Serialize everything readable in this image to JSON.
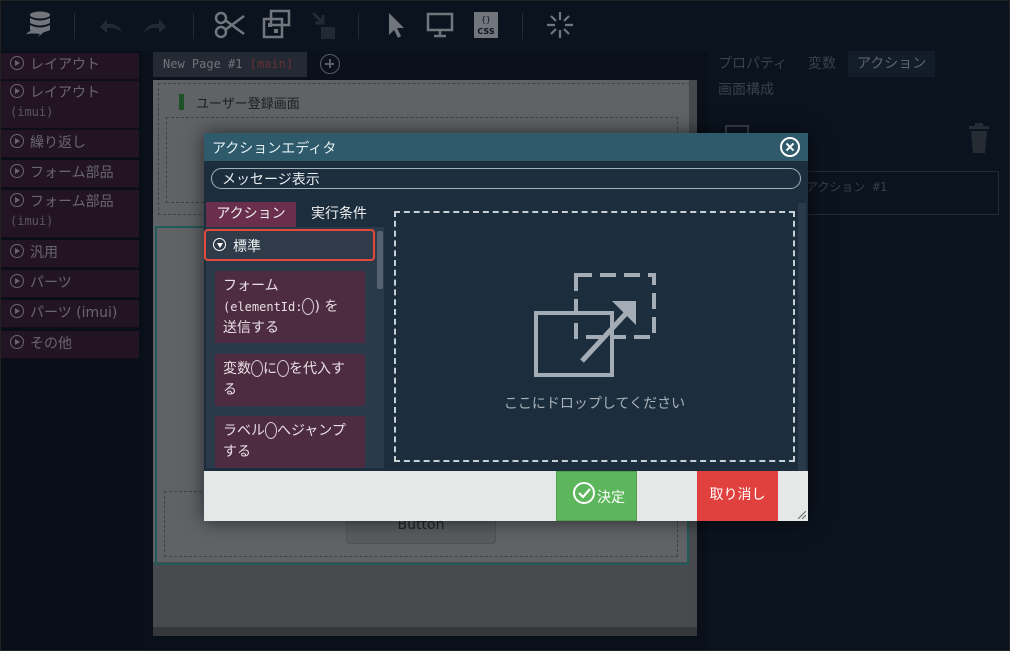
{
  "toolbar": {
    "icons": [
      "database-icon",
      "undo-icon",
      "redo-icon",
      "scissors-icon",
      "copy-icon",
      "paste-icon",
      "cursor-icon",
      "monitor-icon",
      "css-icon",
      "sparkle-icon"
    ],
    "css_label": "CSS"
  },
  "palette": {
    "items": [
      {
        "label": "レイアウト",
        "sub": ""
      },
      {
        "label": "レイアウト",
        "sub": "(imui)"
      },
      {
        "label": "繰り返し",
        "sub": ""
      },
      {
        "label": "フォーム部品",
        "sub": ""
      },
      {
        "label": "フォーム部品",
        "sub": "(imui)"
      },
      {
        "label": "汎用",
        "sub": ""
      },
      {
        "label": "パーツ",
        "sub": ""
      },
      {
        "label": "パーツ (imui)",
        "sub": ""
      },
      {
        "label": "その他",
        "sub": ""
      }
    ]
  },
  "page_tab": {
    "name": "New Page #1",
    "tag": "[main]"
  },
  "canvas": {
    "heading": "ユーザー登録画面",
    "button_label": "Button"
  },
  "right_panel": {
    "tabs": [
      "プロパティ",
      "変数",
      "アクション",
      "画面構成"
    ],
    "action_item": "アクション #1"
  },
  "modal": {
    "title": "アクションエディタ",
    "name_value": "メッセージ表示",
    "tab_action": "アクション",
    "tab_condition": "実行条件",
    "category": "標準",
    "cards": [
      {
        "line1": "フォーム",
        "line2a": "(elementId:",
        "line2b": ") を",
        "line3": "送信する"
      },
      {
        "line1a": "変数",
        "line1b": "に",
        "line1c": "を代入す",
        "line2": "る"
      },
      {
        "line1a": "ラベル",
        "line1b": "へジャンプ",
        "line2": "する"
      }
    ],
    "drop_text": "ここにドロップしてください",
    "ok_label": "決定",
    "cancel_label": "取り消し"
  },
  "colors": {
    "accent_teal": "#2e5a6c",
    "ok_green": "#5cb65c",
    "cancel_red": "#e0403e",
    "highlight": "#e24b3b",
    "palette_bg": "#3a1b31"
  }
}
